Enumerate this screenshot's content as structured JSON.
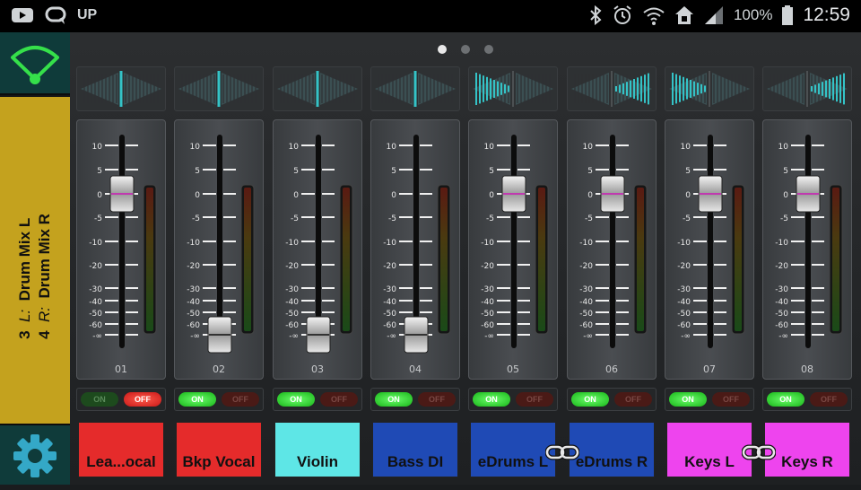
{
  "status_bar": {
    "up_label": "UP",
    "battery": "100%",
    "time": "12:59",
    "icons": [
      "youtube-icon",
      "chat-icon",
      "bluetooth-icon",
      "alarm-icon",
      "wifi-icon",
      "home-icon",
      "signal-icon",
      "battery-icon"
    ]
  },
  "left_panel": {
    "wifi_icon": "wifi-icon",
    "settings_icon": "gear-icon",
    "selector": {
      "line1_num": "3",
      "line1_side": "L:",
      "line1_name": "Drum Mix L",
      "line2_num": "4",
      "line2_side": "R:",
      "line2_name": "Drum Mix R"
    }
  },
  "page_indicator": {
    "count": 3,
    "active": 0
  },
  "fader_scale": [
    "10",
    "5",
    "0",
    "-5",
    "-10",
    "-20",
    "-30",
    "-40",
    "-50",
    "-60",
    "-∞"
  ],
  "channels": [
    {
      "num": "01",
      "name": "Lea...ocal",
      "color": "#e52b2b",
      "on": false,
      "pan": 0.0,
      "fader": "0"
    },
    {
      "num": "02",
      "name": "Bkp Vocal",
      "color": "#e52b2b",
      "on": true,
      "pan": 0.0,
      "fader": "-∞"
    },
    {
      "num": "03",
      "name": "Violin",
      "color": "#5ee6e6",
      "on": true,
      "pan": 0.0,
      "fader": "-∞"
    },
    {
      "num": "04",
      "name": "Bass DI",
      "color": "#1f4ab5",
      "on": true,
      "pan": 0.0,
      "fader": "-∞"
    },
    {
      "num": "05",
      "name": "eDrums L",
      "color": "#1f4ab5",
      "on": true,
      "pan": -1.0,
      "fader": "0"
    },
    {
      "num": "06",
      "name": "eDrums R",
      "color": "#1f4ab5",
      "on": true,
      "pan": 1.0,
      "fader": "0"
    },
    {
      "num": "07",
      "name": "Keys L",
      "color": "#ee44ee",
      "on": true,
      "pan": -1.0,
      "fader": "0"
    },
    {
      "num": "08",
      "name": "Keys R",
      "color": "#ee44ee",
      "on": true,
      "pan": 1.0,
      "fader": "0"
    }
  ],
  "mute_labels": {
    "on": "ON",
    "off": "OFF"
  },
  "links": [
    {
      "between": "05-06",
      "icon": "link-icon"
    },
    {
      "between": "07-08",
      "icon": "link-icon"
    }
  ],
  "colors": {
    "accent": "#34c3c7",
    "selector": "#c4a21e",
    "panel": "#0f3b3a"
  }
}
